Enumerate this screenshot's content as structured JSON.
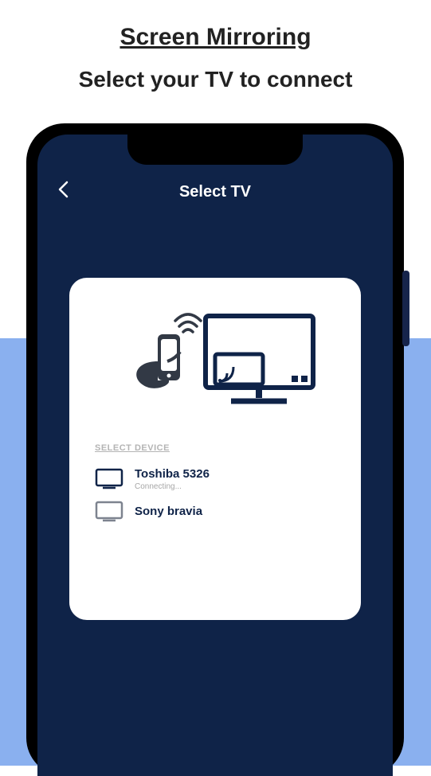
{
  "page": {
    "title": "Screen Mirroring",
    "subtitle": "Select your TV to connect"
  },
  "app": {
    "header_title": "Select TV"
  },
  "card": {
    "section_label": "SELECT DEVICE",
    "devices": [
      {
        "name": "Toshiba 5326",
        "status": "Connecting..."
      },
      {
        "name": "Sony bravia",
        "status": ""
      }
    ]
  }
}
